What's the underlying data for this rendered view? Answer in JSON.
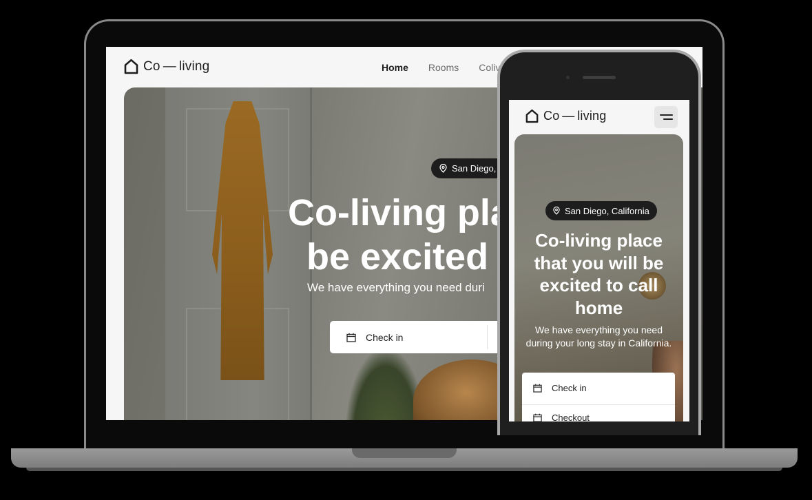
{
  "brand": {
    "logo_text": "Co — living",
    "logo_icon": "house-icon"
  },
  "desktop": {
    "nav": [
      {
        "label": "Home",
        "active": true
      },
      {
        "label": "Rooms",
        "active": false
      },
      {
        "label": "Colivin",
        "active": false
      }
    ],
    "hero": {
      "location": "San Diego, C",
      "title_line1": "Co-living place",
      "title_line2": "be excited to",
      "subtitle": "We have everything you need duri",
      "checkin_label": "Check in"
    }
  },
  "mobile": {
    "menu_icon": "hamburger-menu-icon",
    "hero": {
      "location": "San Diego, California",
      "title_lines": [
        "Co-living place",
        "that you will be",
        "excited to call",
        "home"
      ],
      "subtitle_lines": [
        "We have everything you need",
        "during your long stay in California."
      ],
      "checkin_label": "Check in",
      "checkout_label": "Checkout"
    }
  },
  "colors": {
    "accent_dark": "#1d1d1d",
    "page_bg": "#f6f6f6",
    "card_bg": "#ffffff"
  }
}
